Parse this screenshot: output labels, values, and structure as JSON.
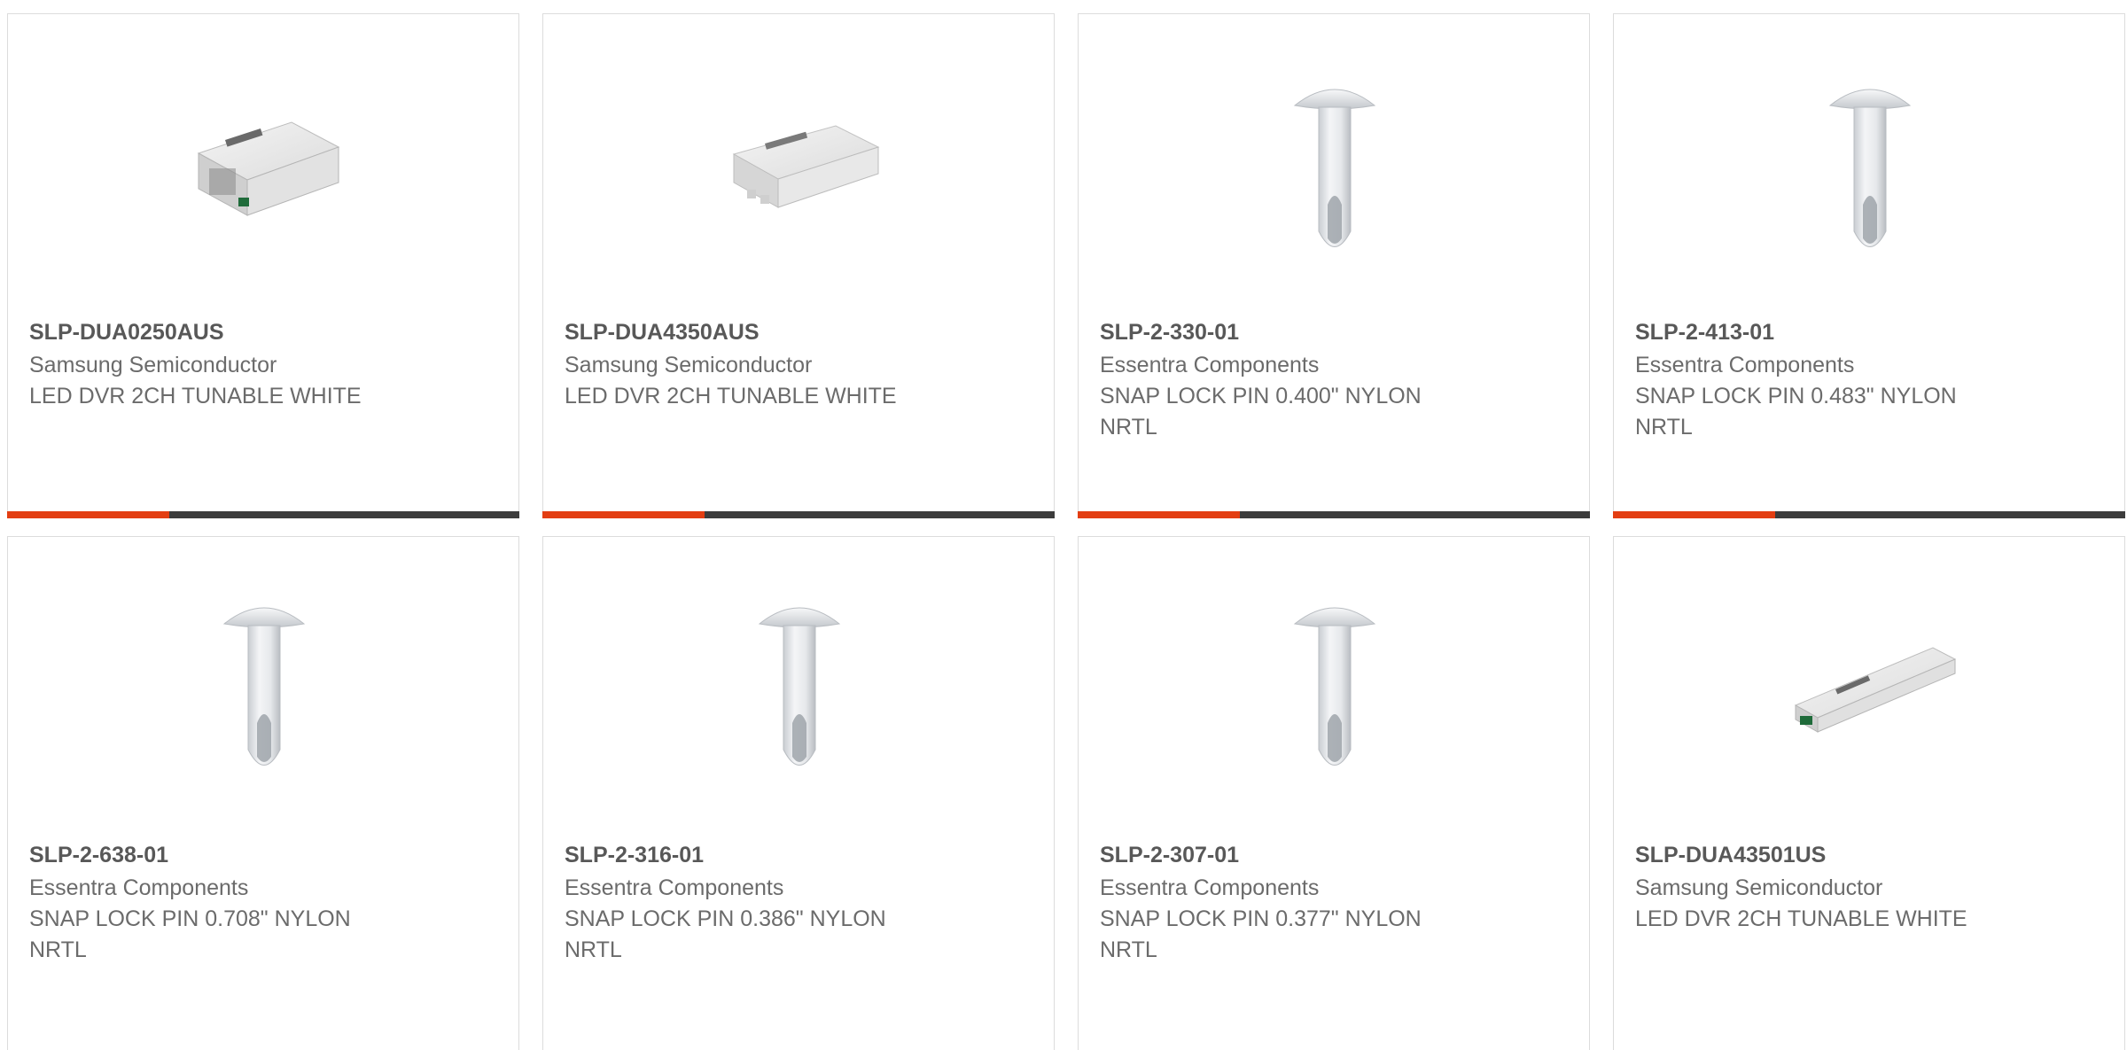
{
  "accent_color": "#e33e12",
  "bar_color": "#3c3c3c",
  "products": [
    {
      "part": "SLP-DUA0250AUS",
      "manufacturer": "Samsung Semiconductor",
      "description": "LED DVR 2CH TUNABLE WHITE",
      "image": "led-driver-module-image"
    },
    {
      "part": "SLP-DUA4350AUS",
      "manufacturer": "Samsung Semiconductor",
      "description": "LED DVR 2CH TUNABLE WHITE",
      "image": "led-driver-module-image"
    },
    {
      "part": "SLP-2-330-01",
      "manufacturer": "Essentra Components",
      "description": "SNAP LOCK PIN 0.400\" NYLON NRTL",
      "image": "snap-lock-pin-image"
    },
    {
      "part": "SLP-2-413-01",
      "manufacturer": "Essentra Components",
      "description": "SNAP LOCK PIN 0.483\" NYLON NRTL",
      "image": "snap-lock-pin-image"
    },
    {
      "part": "SLP-2-638-01",
      "manufacturer": "Essentra Components",
      "description": "SNAP LOCK PIN 0.708\" NYLON NRTL",
      "image": "snap-lock-pin-image"
    },
    {
      "part": "SLP-2-316-01",
      "manufacturer": "Essentra Components",
      "description": "SNAP LOCK PIN 0.386\" NYLON NRTL",
      "image": "snap-lock-pin-image"
    },
    {
      "part": "SLP-2-307-01",
      "manufacturer": "Essentra Components",
      "description": "SNAP LOCK PIN 0.377\" NYLON NRTL",
      "image": "snap-lock-pin-image"
    },
    {
      "part": "SLP-DUA43501US",
      "manufacturer": "Samsung Semiconductor",
      "description": "LED DVR 2CH TUNABLE WHITE",
      "image": "linear-led-driver-image"
    }
  ]
}
